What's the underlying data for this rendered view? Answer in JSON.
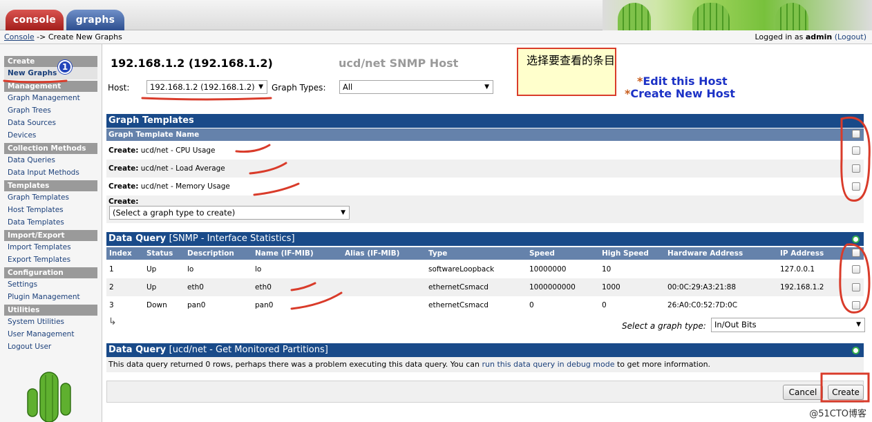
{
  "tabs": {
    "console": "console",
    "graphs": "graphs"
  },
  "breadcrumb": {
    "root": "Console",
    "separator": "->",
    "current": "Create New Graphs"
  },
  "login": {
    "prefix": "Logged in as",
    "user": "admin",
    "logout": "(Logout)"
  },
  "sidebar": {
    "sections": [
      {
        "heading": "Create",
        "items": [
          "New Graphs"
        ]
      },
      {
        "heading": "Management",
        "items": [
          "Graph Management",
          "Graph Trees",
          "Data Sources",
          "Devices"
        ]
      },
      {
        "heading": "Collection Methods",
        "items": [
          "Data Queries",
          "Data Input Methods"
        ]
      },
      {
        "heading": "Templates",
        "items": [
          "Graph Templates",
          "Host Templates",
          "Data Templates"
        ]
      },
      {
        "heading": "Import/Export",
        "items": [
          "Import Templates",
          "Export Templates"
        ]
      },
      {
        "heading": "Configuration",
        "items": [
          "Settings",
          "Plugin Management"
        ]
      },
      {
        "heading": "Utilities",
        "items": [
          "System Utilities",
          "User Management",
          "Logout User"
        ]
      }
    ],
    "selected": "New Graphs"
  },
  "header": {
    "host_title": "192.168.1.2 (192.168.1.2)",
    "host_type": "ucd/net SNMP Host",
    "host_label": "Host:",
    "host_value": "192.168.1.2 (192.168.1.2)",
    "graph_types_label": "Graph Types:",
    "graph_types_value": "All",
    "edit_host": "Edit this Host",
    "create_host": "Create New Host",
    "star": "*"
  },
  "annotation": {
    "note": "选择要查看的条目",
    "badge": "1"
  },
  "graph_templates": {
    "title": "Graph Templates",
    "column": "Graph Template Name",
    "rows": [
      {
        "prefix": "Create:",
        "name": "ucd/net - CPU Usage"
      },
      {
        "prefix": "Create:",
        "name": "ucd/net - Load Average"
      },
      {
        "prefix": "Create:",
        "name": "ucd/net - Memory Usage"
      }
    ],
    "create_label": "Create:",
    "create_select": "(Select a graph type to create)"
  },
  "data_query": {
    "title": "Data Query",
    "subtitle": "[SNMP - Interface Statistics]",
    "columns": [
      "Index",
      "Status",
      "Description",
      "Name (IF-MIB)",
      "Alias (IF-MIB)",
      "Type",
      "Speed",
      "High Speed",
      "Hardware Address",
      "IP Address"
    ],
    "rows": [
      {
        "index": "1",
        "status": "Up",
        "description": "lo",
        "name": "lo",
        "alias": "",
        "type": "softwareLoopback",
        "speed": "10000000",
        "high_speed": "10",
        "hw": "",
        "ip": "127.0.0.1"
      },
      {
        "index": "2",
        "status": "Up",
        "description": "eth0",
        "name": "eth0",
        "alias": "",
        "type": "ethernetCsmacd",
        "speed": "1000000000",
        "high_speed": "1000",
        "hw": "00:0C:29:A3:21:88",
        "ip": "192.168.1.2"
      },
      {
        "index": "3",
        "status": "Down",
        "description": "pan0",
        "name": "pan0",
        "alias": "",
        "type": "ethernetCsmacd",
        "speed": "0",
        "high_speed": "0",
        "hw": "26:A0:C0:52:7D:0C",
        "ip": ""
      }
    ],
    "select_type_label": "Select a graph type:",
    "select_type_value": "In/Out Bits"
  },
  "partitions": {
    "title": "Data Query",
    "subtitle": "[ucd/net - Get Monitored Partitions]",
    "msg_before": "This data query returned 0 rows, perhaps there was a problem executing this data query. You can ",
    "msg_link": "run this data query in debug mode",
    "msg_after": " to get more information."
  },
  "footer": {
    "cancel": "Cancel",
    "create": "Create"
  },
  "watermark": "@51CTO博客",
  "colors": {
    "panel_header": "#194a89",
    "col_header": "#6582ab",
    "annotation_red": "#d93b2a"
  }
}
